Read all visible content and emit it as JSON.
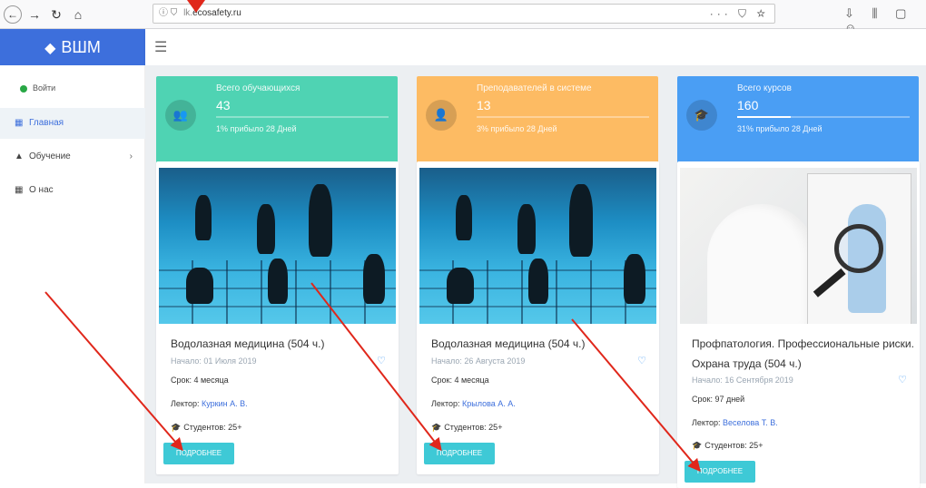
{
  "browser": {
    "url_security": "ⓘ ⛉",
    "url_prefix": "lk.",
    "url_host": "ecosafety.ru",
    "url_actions": "··· ⛉ ☆",
    "toolbar_icons": "⇩ ⫼ ▢ ☺"
  },
  "brand": {
    "name": "ВШМ"
  },
  "sidebar": {
    "login": "Войти",
    "items": [
      {
        "label": "Главная",
        "icon": "dashboard-icon"
      },
      {
        "label": "Обучение",
        "icon": "cap-icon"
      },
      {
        "label": "О нас",
        "icon": "grid-icon"
      }
    ]
  },
  "stats": [
    {
      "label": "Всего обучающихся",
      "value": "43",
      "sub": "1% прибыло 28 Дней",
      "progress": 0.0,
      "color": "#4fd3b3"
    },
    {
      "label": "Преподавателей в системе",
      "value": "13",
      "sub": "3% прибыло 28 Дней",
      "progress": 0.0,
      "color": "#fdbb63"
    },
    {
      "label": "Всего курсов",
      "value": "160",
      "sub": "31% прибыло 28 Дней",
      "progress": 0.31,
      "color": "#4a9ef4"
    }
  ],
  "courses": [
    {
      "title": "Водолазная медицина (504 ч.)",
      "start": "Начало: 01 Июля 2019",
      "term": "Срок: 4 месяца",
      "lector_label": "Лектор:",
      "lector_name": "Куркин А. В.",
      "students": "Студентов: 25+",
      "button": "ПОДРОБНЕЕ"
    },
    {
      "title": "Водолазная медицина (504 ч.)",
      "start": "Начало: 26 Августа 2019",
      "term": "Срок: 4 месяца",
      "lector_label": "Лектор:",
      "lector_name": "Крылова А. А.",
      "students": "Студентов: 25+",
      "button": "ПОДРОБНЕЕ"
    },
    {
      "title": "Профпатология. Профессиональные риски. Охрана труда (504 ч.)",
      "start": "Начало: 16 Сентября 2019",
      "term": "Срок: 97 дней",
      "lector_label": "Лектор:",
      "lector_name": "Веселова Т. В.",
      "students": "Студентов: 25+",
      "button": "ПОДРОБНЕЕ"
    }
  ]
}
